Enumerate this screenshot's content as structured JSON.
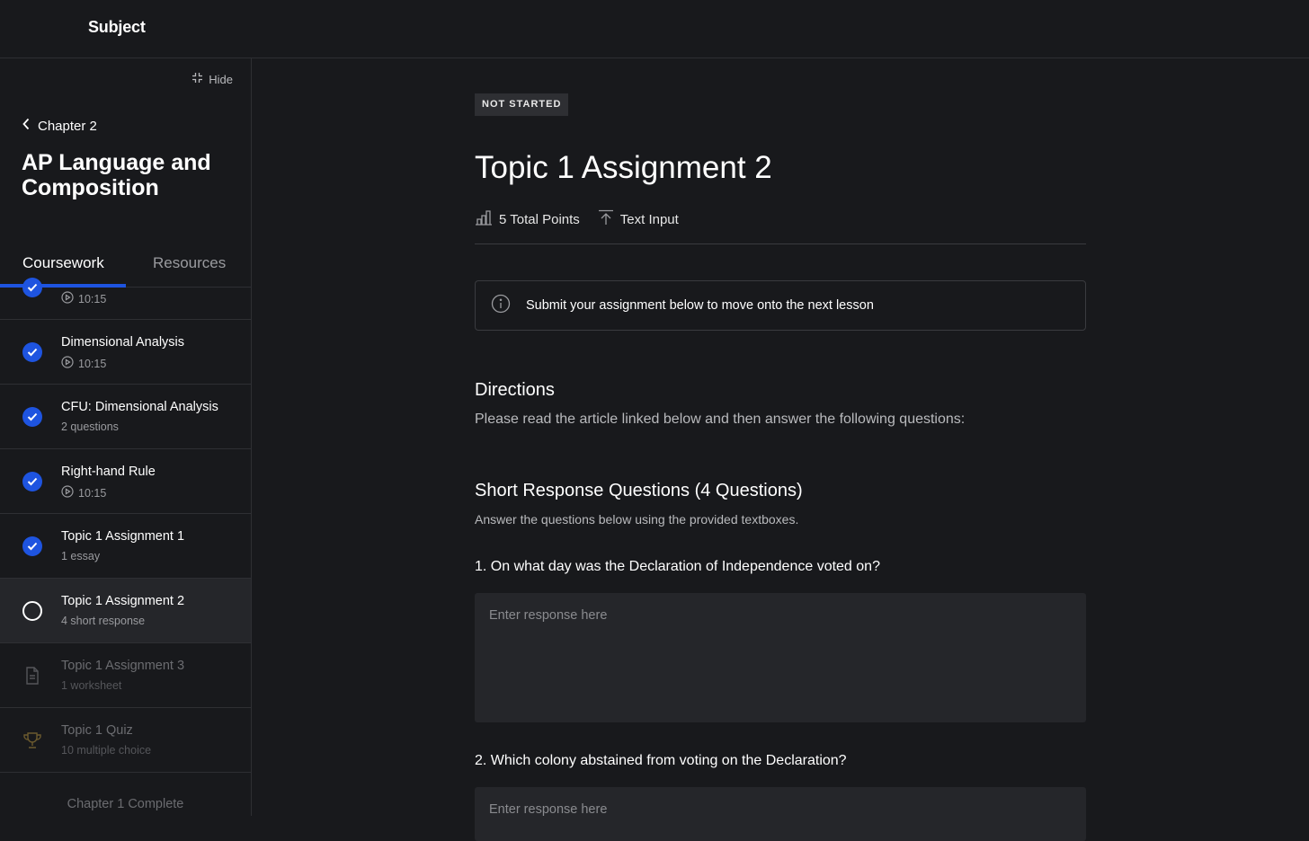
{
  "app": {
    "brand": "Subject"
  },
  "sidebar": {
    "hide_label": "Hide",
    "back_label": "Chapter 2",
    "course_title": "AP Language and Composition",
    "tabs": {
      "coursework": "Coursework",
      "resources": "Resources"
    },
    "items": [
      {
        "title": "",
        "sub": "10:15",
        "status": "complete",
        "sub_icon": "play-icon"
      },
      {
        "title": "Dimensional Analysis",
        "sub": "10:15",
        "status": "complete",
        "sub_icon": "play-icon"
      },
      {
        "title": "CFU: Dimensional Analysis",
        "sub": "2 questions",
        "status": "complete"
      },
      {
        "title": "Right-hand Rule",
        "sub": "10:15",
        "status": "complete",
        "sub_icon": "play-icon"
      },
      {
        "title": "Topic 1 Assignment 1",
        "sub": "1 essay",
        "status": "complete"
      },
      {
        "title": "Topic 1 Assignment 2",
        "sub": "4 short response",
        "status": "current"
      },
      {
        "title": "Topic 1 Assignment 3",
        "sub": "1 worksheet",
        "status": "locked",
        "icon": "document-icon"
      },
      {
        "title": "Topic 1 Quiz",
        "sub": "10 multiple choice",
        "status": "locked",
        "icon": "trophy-icon"
      }
    ],
    "chapter_complete": "Chapter 1 Complete"
  },
  "main": {
    "badge": "NOT STARTED",
    "title": "Topic 1 Assignment 2",
    "points": "5 Total Points",
    "submission_type": "Text Input",
    "notice": "Submit your assignment below to move onto the next lesson",
    "directions_heading": "Directions",
    "directions_text": "Please read the article linked below and then answer the following questions:",
    "short_response_heading": "Short Response Questions (4 Questions)",
    "short_response_sub": "Answer the questions below using the provided textboxes.",
    "questions": [
      {
        "text": "1. On what day was the Declaration of Independence voted on?",
        "placeholder": "Enter response here"
      },
      {
        "text": "2. Which colony abstained from voting on the Declaration?",
        "placeholder": "Enter response here"
      }
    ]
  },
  "colors": {
    "accent": "#1e54e0",
    "background": "#18191c",
    "surface": "#25262a",
    "border": "#2e2f33",
    "trophy": "#6b5a2e"
  }
}
